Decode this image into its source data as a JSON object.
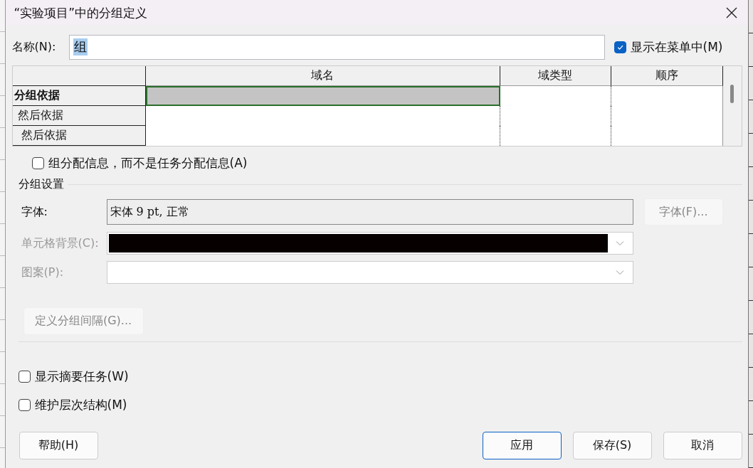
{
  "window": {
    "title": "“实验项目”中的分组定义"
  },
  "name_field": {
    "label": "名称(N):",
    "value": "组",
    "value_highlighted": true
  },
  "show_in_menu": {
    "label": "显示在菜单中(M)",
    "checked": true
  },
  "group_grid": {
    "columns": [
      "域名",
      "域类型",
      "顺序"
    ],
    "rows": [
      {
        "label": "分组依据",
        "selected": true,
        "children": [
          {
            "label": "然后依据",
            "selected": false,
            "children": [
              {
                "label": "然后依据",
                "selected": false
              }
            ]
          }
        ]
      }
    ]
  },
  "assignment_checkbox": {
    "label": "组分配信息，而不是任务分配信息(A)",
    "checked": false
  },
  "group_settings": {
    "title": "分组设置",
    "font": {
      "label": "字体:",
      "value": "宋体 9 pt, 正常",
      "button": "字体(F)...",
      "button_disabled": true
    },
    "cell_background": {
      "label": "单元格背景(C):",
      "color": "#070000",
      "disabled": true
    },
    "pattern": {
      "label": "图案(P):",
      "disabled": true
    },
    "interval_button": {
      "label": "定义分组间隔(G)...",
      "disabled": true
    }
  },
  "options": [
    {
      "label": "显示摘要任务(W)",
      "checked": false
    },
    {
      "label": "维护层次结构(M)",
      "checked": false
    }
  ],
  "help_button": {
    "label": "帮助(H)"
  },
  "buttons": [
    {
      "label": "应用",
      "default": true
    },
    {
      "label": "保存(S)",
      "default": false
    },
    {
      "label": "取消",
      "default": false
    }
  ]
}
